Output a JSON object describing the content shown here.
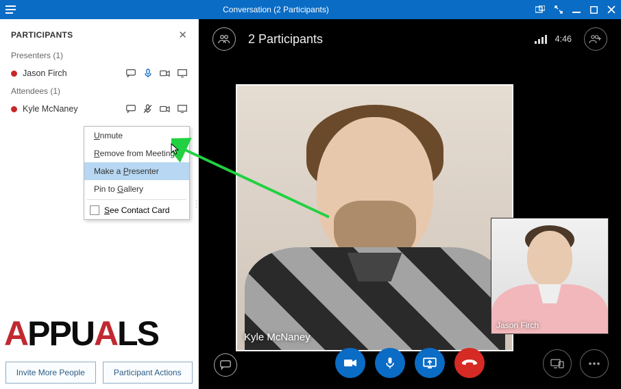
{
  "window": {
    "title": "Conversation (2 Participants)"
  },
  "sidebar": {
    "header": "PARTICIPANTS",
    "presenters_label": "Presenters (1)",
    "attendees_label": "Attendees (1)",
    "presenters": [
      {
        "name": "Jason Firch"
      }
    ],
    "attendees": [
      {
        "name": "Kyle McNaney"
      }
    ],
    "invite_btn": "Invite More People",
    "actions_btn": "Participant Actions"
  },
  "context_menu": {
    "items": [
      "Unmute",
      "Remove from Meeting",
      "Make a Presenter",
      "Pin to Gallery"
    ],
    "card": "See Contact Card",
    "underline_chars": [
      "U",
      "R",
      "P",
      "G",
      "S"
    ]
  },
  "video": {
    "participants_label": "2 Participants",
    "time": "4:46",
    "tile_names": {
      "main": "Kyle McNaney",
      "pip": "Jason Firch"
    }
  },
  "watermark": {
    "a": "A",
    "rest": "PUALS"
  },
  "colors": {
    "primary": "#0a6cc5",
    "hangup": "#d62a24",
    "arrow": "#21d142"
  }
}
